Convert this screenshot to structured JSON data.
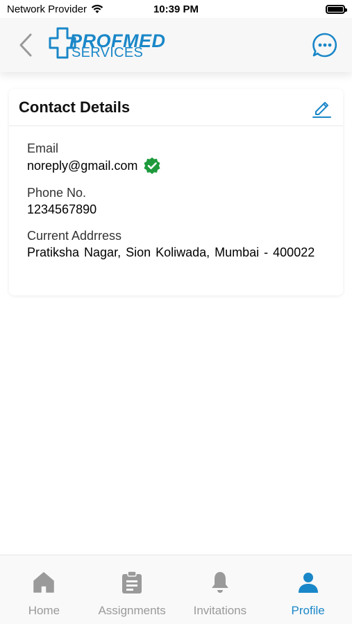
{
  "status_bar": {
    "carrier": "Network Provider",
    "time": "10:39 PM"
  },
  "header": {
    "logo_line1": "PROFMED",
    "logo_line2": "SERVICES",
    "back_icon": "chevron-left-icon",
    "chat_icon": "chat-bubble-icon"
  },
  "contact": {
    "title": "Contact Details",
    "fields": [
      {
        "label": "Email",
        "value": "noreply@gmail.com",
        "verified": true
      },
      {
        "label": "Phone No.",
        "value": "1234567890"
      },
      {
        "label": "Current Addrress",
        "value": "Pratiksha Nagar, Sion Koliwada, Mumbai - 400022"
      }
    ]
  },
  "tabs": [
    {
      "label": "Home",
      "icon": "home-icon",
      "active": false
    },
    {
      "label": "Assignments",
      "icon": "clipboard-icon",
      "active": false
    },
    {
      "label": "Invitations",
      "icon": "bell-icon",
      "active": false
    },
    {
      "label": "Profile",
      "icon": "person-icon",
      "active": true
    }
  ],
  "colors": {
    "accent": "#1a87c8",
    "verified": "#1e9a3c",
    "inactive": "#9a9a9a"
  }
}
